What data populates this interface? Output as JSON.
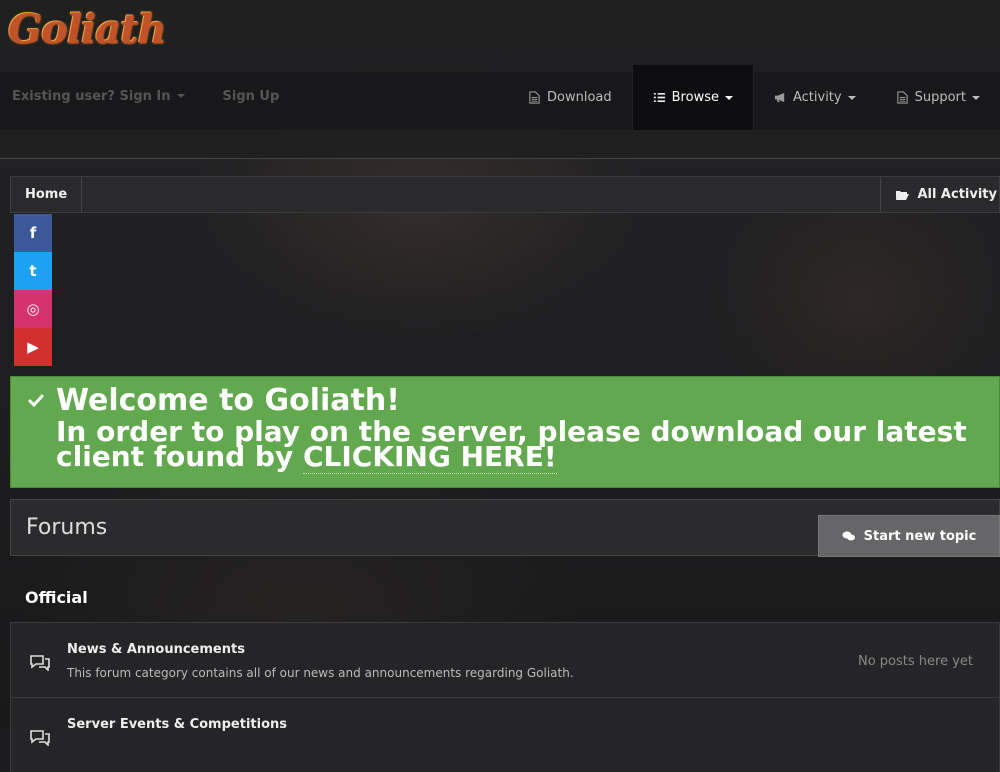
{
  "brand": {
    "logo_text": "Goliath"
  },
  "nav": {
    "left": {
      "sign_in": "Existing user? Sign In",
      "sign_up": "Sign Up"
    },
    "items": [
      {
        "label": "Download",
        "icon": "file-icon"
      },
      {
        "label": "Browse",
        "icon": "list-icon",
        "active": true
      },
      {
        "label": "Activity",
        "icon": "megaphone-icon"
      },
      {
        "label": "Support",
        "icon": "file-icon"
      }
    ]
  },
  "breadcrumb": {
    "home": "Home",
    "all_activity": "All Activity"
  },
  "social": {
    "facebook": "f",
    "twitter": "t",
    "instagram": "◎",
    "youtube": "▶"
  },
  "welcome": {
    "title": "Welcome to Goliath!",
    "body_prefix": "In order to play on the server, please download our latest client found by ",
    "link_text": "CLICKING HERE!"
  },
  "forums": {
    "title": "Forums",
    "start_topic": "Start new topic",
    "category": "Official",
    "rows": [
      {
        "name": "News & Announcements",
        "description": "This forum category contains all of our news and announcements regarding Goliath.",
        "last_post": "No posts here yet"
      },
      {
        "name": "Server Events & Competitions",
        "description": "",
        "last_post": ""
      }
    ]
  },
  "colors": {
    "success": "#62a84f",
    "active_nav": "#0e0e10",
    "accent_logo": "#c0532a"
  }
}
